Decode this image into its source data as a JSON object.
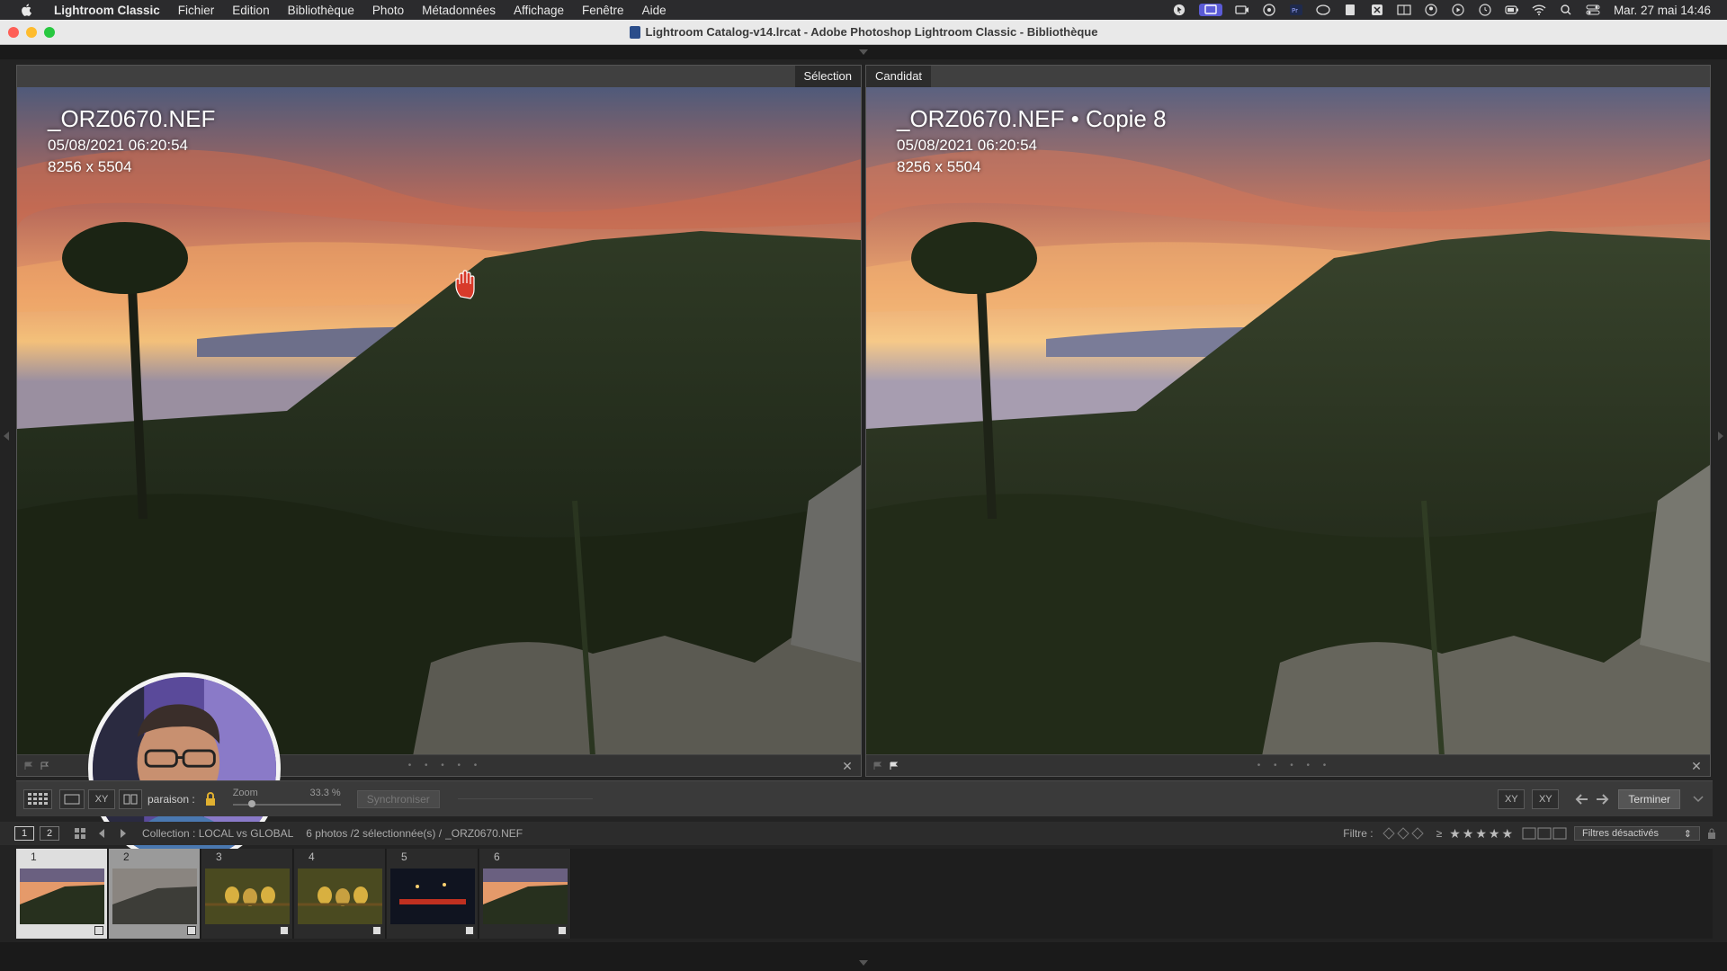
{
  "menubar": {
    "app_name": "Lightroom Classic",
    "items": [
      "Fichier",
      "Edition",
      "Bibliothèque",
      "Photo",
      "Métadonnées",
      "Affichage",
      "Fenêtre",
      "Aide"
    ],
    "clock": "Mar. 27 mai  14:46"
  },
  "window": {
    "title": "Lightroom Catalog-v14.lrcat - Adobe Photoshop Lightroom Classic - Bibliothèque"
  },
  "compare": {
    "select_label": "Sélection",
    "candidate_label": "Candidat",
    "left": {
      "filename": "_ORZ0670.NEF",
      "date": "05/08/2021 06:20:54",
      "dimensions": "8256 x 5504"
    },
    "right": {
      "filename": "_ORZ0670.NEF  •  Copie 8",
      "date": "05/08/2021 06:20:54",
      "dimensions": "8256 x 5504"
    }
  },
  "toolbar": {
    "compare_label": "paraison :",
    "zoom_label": "Zoom",
    "zoom_value": "33.3 %",
    "zoom_level": 0.15,
    "sync_label": "Synchroniser",
    "done_label": "Terminer",
    "xy_label": "XY"
  },
  "filmstrip_header": {
    "screen1": "1",
    "screen2": "2",
    "collection_prefix": "Collection : LOCAL vs GLOBAL",
    "count": "6 photos /2 sélectionnée(s) /",
    "current_file": "_ORZ0670.NEF",
    "filter_label": "Filtre :",
    "rating_op": "≥",
    "stars": "★★★★★",
    "filter_dropdown": "Filtres désactivés"
  },
  "filmstrip": {
    "cells": [
      {
        "num": "1",
        "kind": "sunset"
      },
      {
        "num": "2",
        "kind": "grey"
      },
      {
        "num": "3",
        "kind": "birds"
      },
      {
        "num": "4",
        "kind": "birds"
      },
      {
        "num": "5",
        "kind": "night"
      },
      {
        "num": "6",
        "kind": "sunset"
      }
    ]
  },
  "colors": {
    "accent": "#5b5bd6",
    "traffic_red": "#fe5f57",
    "traffic_yellow": "#febc2e",
    "traffic_green": "#28c840"
  }
}
